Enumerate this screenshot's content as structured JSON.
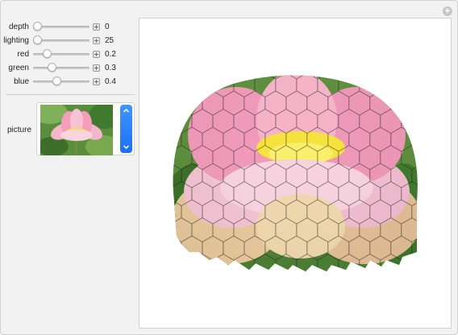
{
  "controls": [
    {
      "label": "depth",
      "value": "0",
      "fraction": 0.0
    },
    {
      "label": "lighting",
      "value": "25",
      "fraction": 0.0
    },
    {
      "label": "red",
      "value": "0.2",
      "fraction": 0.2
    },
    {
      "label": "green",
      "value": "0.3",
      "fraction": 0.3
    },
    {
      "label": "blue",
      "value": "0.4",
      "fraction": 0.4
    }
  ],
  "picture": {
    "label": "picture"
  },
  "colors": {
    "panel": "#f2f2f2",
    "accent": "#2a80f7",
    "petal_pink": "#f1a4c2",
    "stamen_yellow": "#f6e53a",
    "leaf_green": "#4e8a32"
  },
  "icons": [
    "add-icon",
    "plus-icon",
    "chevron-up-icon",
    "chevron-down-icon"
  ]
}
